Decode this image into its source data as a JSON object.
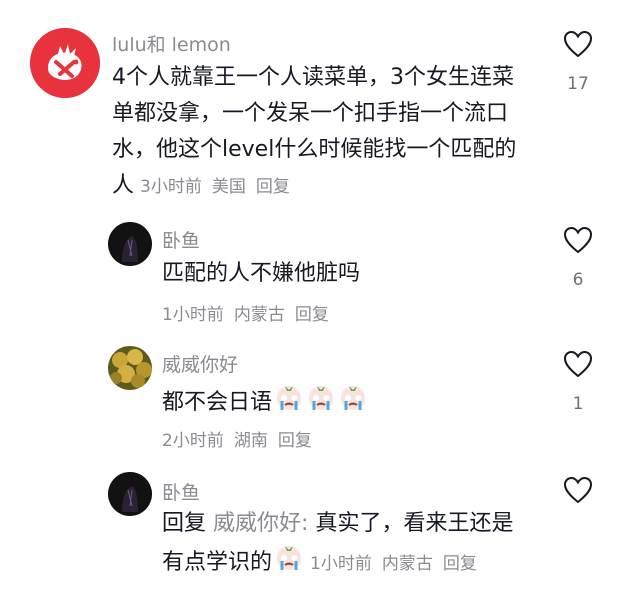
{
  "comments": [
    {
      "username": "lulu和 lemon",
      "text_lines": [
        "4个人就靠王一个人读菜单，3个女生连菜",
        "单都没拿，一个发呆一个扣手指一个流口",
        "水，他这个level什么时候能找一个匹配的",
        "人"
      ],
      "time": "3小时前",
      "location": "美国",
      "reply_label": "回复",
      "likes": "17",
      "avatar_color": "#e8333f"
    },
    {
      "username": "卧鱼",
      "text": "匹配的人不嫌他脏吗",
      "time": "1小时前",
      "location": "内蒙古",
      "reply_label": "回复",
      "likes": "6",
      "avatar_color": "#121212"
    },
    {
      "username": "威威你好",
      "text": "都不会日语",
      "time": "2小时前",
      "location": "湖南",
      "reply_label": "回复",
      "likes": "1",
      "avatar_color": "#9a8a2a"
    },
    {
      "username": "卧鱼",
      "reply_prefix": "回复",
      "reply_to": "威威你好:",
      "text_line1": "真实了，看来王还是",
      "text_line2": "有点学识的",
      "time": "1小时前",
      "location": "内蒙古",
      "reply_label": "回复",
      "avatar_color": "#121212"
    }
  ],
  "icons": {
    "like": "heart-outline-icon",
    "emoji": "crying-face-emoji"
  },
  "colors": {
    "text": "#161823",
    "secondary": "#8a8b91",
    "brand_red": "#e8333f"
  }
}
